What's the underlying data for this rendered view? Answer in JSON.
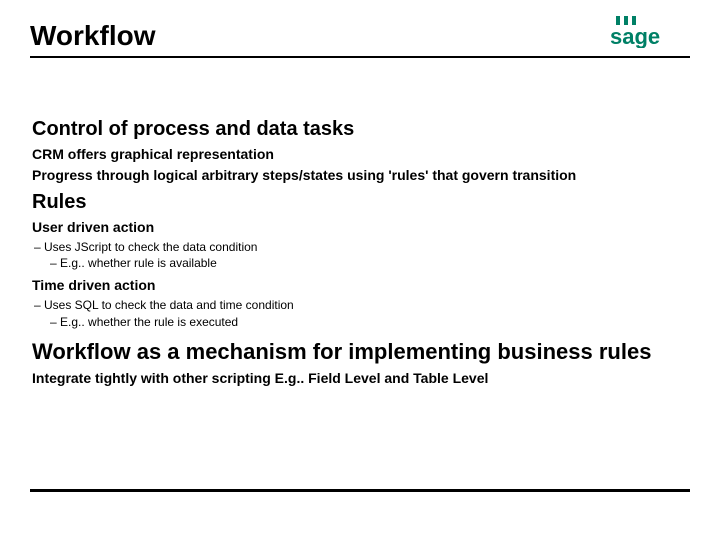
{
  "title": "Workflow",
  "logo": {
    "text": "sage",
    "color": "#008066"
  },
  "section1": {
    "heading": "Control of process and data tasks",
    "line1": "CRM offers graphical representation",
    "line2": "Progress through logical arbitrary steps/states using 'rules' that govern transition"
  },
  "section2": {
    "heading": "Rules",
    "item1": {
      "title": "User driven action",
      "sub1": "– Uses JScript to check the data condition",
      "sub2": "– E.g.. whether rule is available"
    },
    "item2": {
      "title": "Time driven action",
      "sub1": "– Uses SQL to check the data and time condition",
      "sub2": "– E.g.. whether the rule is executed"
    }
  },
  "section3": {
    "heading": "Workflow as a mechanism for implementing business rules",
    "line1": "Integrate tightly with other scripting E.g.. Field Level and Table Level"
  }
}
